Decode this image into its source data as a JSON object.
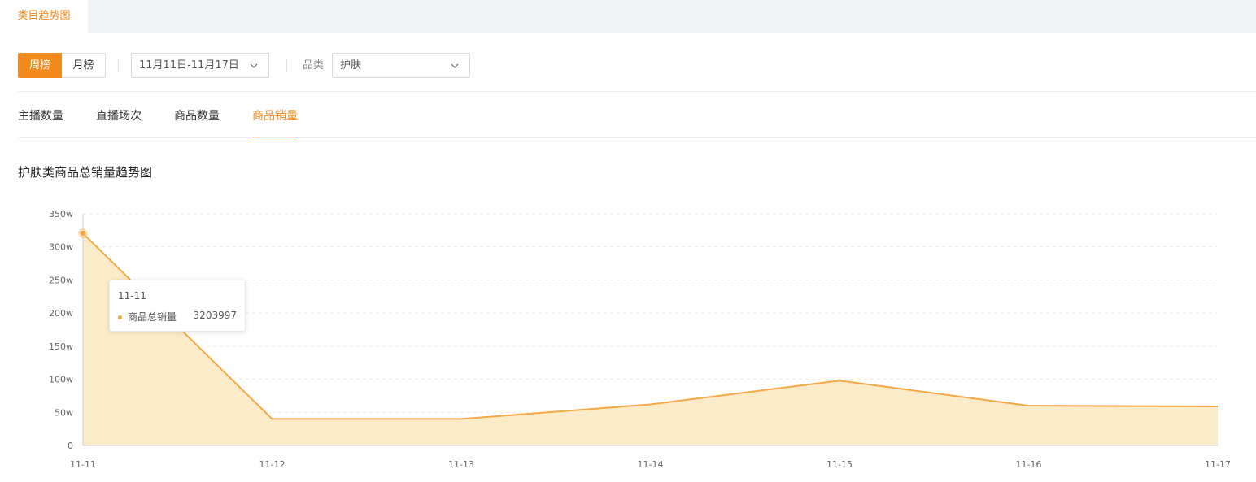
{
  "top_tab": {
    "label": "类目趋势图"
  },
  "filters": {
    "period_tabs": [
      {
        "label": "周榜",
        "active": true
      },
      {
        "label": "月榜",
        "active": false
      }
    ],
    "date_range": "11月11日-11月17日",
    "category_label": "品类",
    "category_value": "护肤"
  },
  "metric_tabs": [
    {
      "label": "主播数量",
      "active": false
    },
    {
      "label": "直播场次",
      "active": false
    },
    {
      "label": "商品数量",
      "active": false
    },
    {
      "label": "商品销量",
      "active": true
    }
  ],
  "chart_title": "护肤类商品总销量趋势图",
  "tooltip": {
    "title": "11-11",
    "series_name": "商品总销量",
    "value": "3203997"
  },
  "colors": {
    "accent": "#f2891d",
    "line": "#f5a946",
    "area": "#fcebc8"
  },
  "chart_data": {
    "type": "area",
    "categories": [
      "11-11",
      "11-12",
      "11-13",
      "11-14",
      "11-15",
      "11-16",
      "11-17"
    ],
    "series": [
      {
        "name": "商品总销量",
        "values": [
          3203997,
          400000,
          400000,
          620000,
          980000,
          600000,
          590000
        ]
      }
    ],
    "y_ticks": [
      "0",
      "50w",
      "100w",
      "150w",
      "200w",
      "250w",
      "300w",
      "350w"
    ],
    "ylim": [
      0,
      3500000
    ],
    "grid": true
  }
}
